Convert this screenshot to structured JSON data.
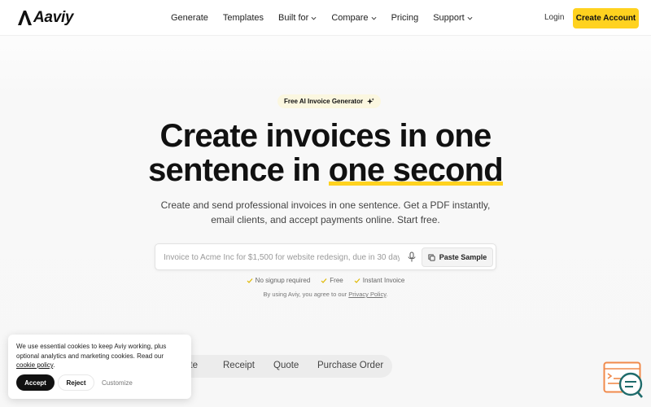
{
  "header": {
    "logo_text": "Aaviy",
    "nav": [
      {
        "label": "Generate",
        "dropdown": false
      },
      {
        "label": "Templates",
        "dropdown": false
      },
      {
        "label": "Built for",
        "dropdown": true
      },
      {
        "label": "Compare",
        "dropdown": true
      },
      {
        "label": "Pricing",
        "dropdown": false
      },
      {
        "label": "Support",
        "dropdown": true
      }
    ],
    "login_label": "Login",
    "cta_label": "Create Account"
  },
  "hero": {
    "badge": "Free AI Invoice Generator",
    "title_line1": "Create invoices in one",
    "title_line2_pre": "sentence in ",
    "title_line2_highlight": "one second",
    "subtitle_line1": "Create and send professional invoices in one sentence. Get a PDF instantly,",
    "subtitle_line2": "email clients, and accept payments online. Start free.",
    "input_placeholder": "Invoice to Acme Inc for $1,500 for website redesign, due in 30 days",
    "paste_label": "Paste Sample",
    "checks": [
      "No signup required",
      "Free",
      "Instant Invoice"
    ],
    "terms_prefix": "By using Aviy, you agree to our ",
    "terms_link": "Privacy Policy",
    "terms_suffix": "."
  },
  "tabs": [
    "ote",
    "Receipt",
    "Quote",
    "Purchase Order"
  ],
  "cookie": {
    "text": "We use essential cookies to keep Aviy working, plus optional analytics and marketing cookies. Read our ",
    "link": "cookie policy",
    "text_end": ".",
    "accept": "Accept",
    "reject": "Reject",
    "customize": "Customize"
  },
  "colors": {
    "accent": "#ffd21f",
    "check": "#e0b800",
    "chat_orange": "#f08a4b",
    "chat_teal": "#1e6b6b"
  },
  "icons": {
    "mic": "microphone-icon",
    "paste": "copy-icon",
    "badge": "sparkle-icon",
    "check": "checkmark-icon",
    "chat": "chat-widget-icon"
  }
}
